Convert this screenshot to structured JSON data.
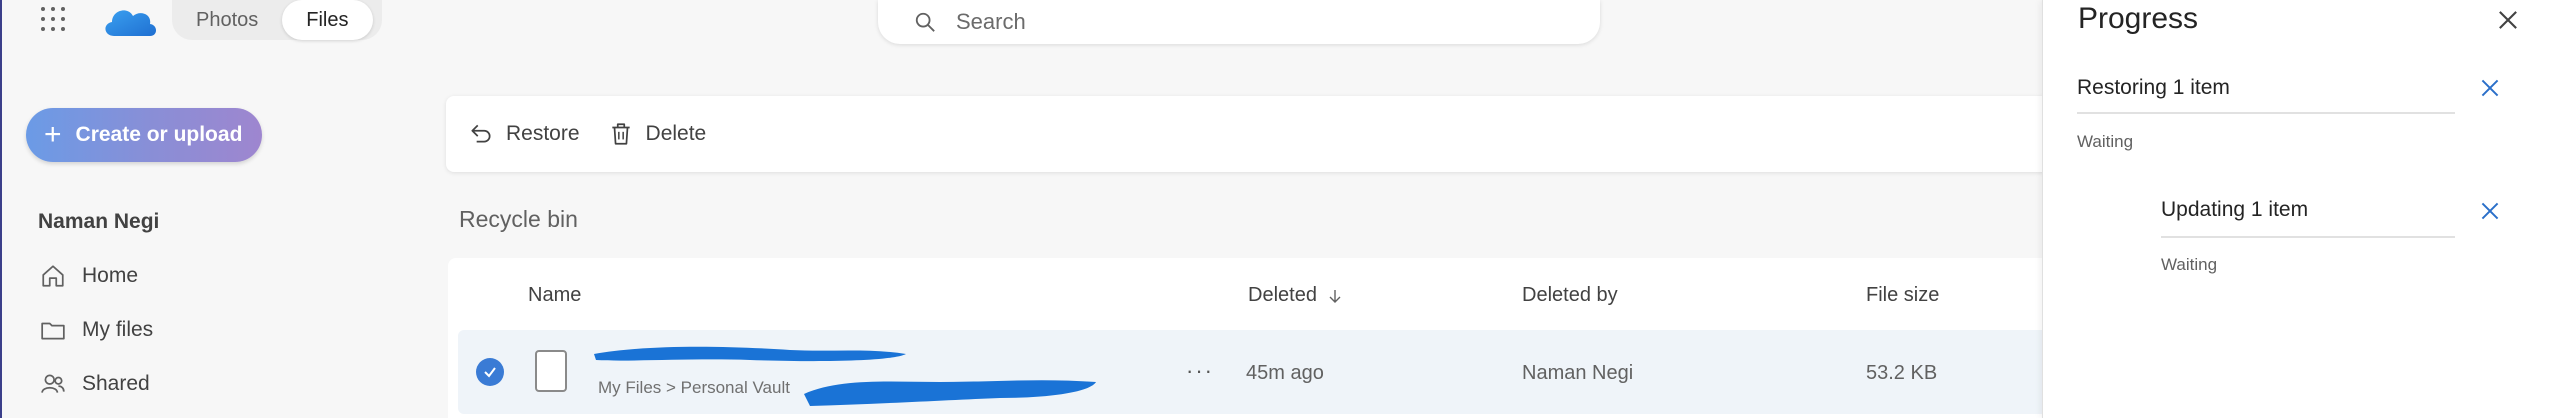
{
  "header": {
    "tabs": [
      {
        "label": "Photos",
        "active": false
      },
      {
        "label": "Files",
        "active": true
      }
    ],
    "search_placeholder": "Search"
  },
  "sidebar": {
    "create_label": "Create or upload",
    "user_name": "Naman Negi",
    "items": [
      {
        "label": "Home",
        "icon": "home-icon"
      },
      {
        "label": "My files",
        "icon": "folder-icon"
      },
      {
        "label": "Shared",
        "icon": "people-icon"
      }
    ]
  },
  "command_bar": {
    "restore_label": "Restore",
    "delete_label": "Delete"
  },
  "main": {
    "title": "Recycle bin",
    "columns": {
      "name": "Name",
      "deleted": "Deleted",
      "deleted_by": "Deleted by",
      "file_size": "File size"
    },
    "rows": [
      {
        "path": "My Files > Personal Vault",
        "deleted": "45m ago",
        "deleted_by": "Naman Negi",
        "file_size": "53.2 KB",
        "selected": true
      }
    ]
  },
  "progress_panel": {
    "title": "Progress",
    "jobs": [
      {
        "label": "Restoring 1 item",
        "status": "Waiting"
      },
      {
        "label": "Updating 1 item",
        "status": "Waiting"
      }
    ]
  },
  "colors": {
    "accent": "#3a7bd5",
    "create_gradient_start": "#6b9be6",
    "create_gradient_end": "#9e86cf",
    "selected_row": "#eff4f9",
    "redaction": "#1a73d6"
  }
}
